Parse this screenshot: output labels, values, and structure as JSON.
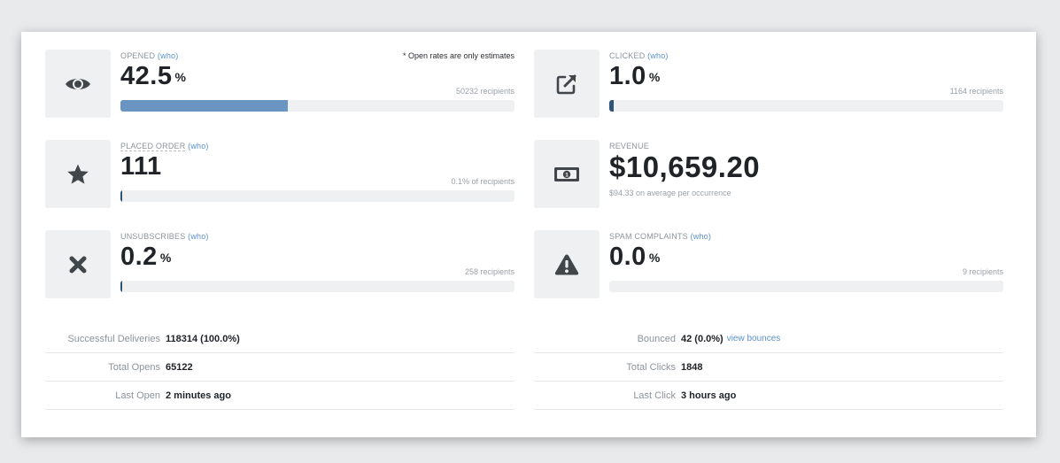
{
  "metrics": {
    "opened": {
      "label": "OPENED",
      "who": "(who)",
      "value": "42.5",
      "unit": "%",
      "note": "* Open rates are only estimates",
      "recipients": "50232 recipients",
      "progress": 0.425
    },
    "clicked": {
      "label": "CLICKED",
      "who": "(who)",
      "value": "1.0",
      "unit": "%",
      "recipients": "1164 recipients",
      "progress": 0.01
    },
    "placed_order": {
      "label": "PLACED ORDER",
      "who": "(who)",
      "value": "111",
      "recipients": "0.1% of recipients",
      "progress": 0.001
    },
    "revenue": {
      "label": "REVENUE",
      "value": "$10,659.20",
      "average": "$94.33 on average per occurrence"
    },
    "unsubscribes": {
      "label": "UNSUBSCRIBES",
      "who": "(who)",
      "value": "0.2",
      "unit": "%",
      "recipients": "258 recipients",
      "progress": 0.002
    },
    "spam": {
      "label": "SPAM COMPLAINTS",
      "who": "(who)",
      "value": "0.0",
      "unit": "%",
      "recipients": "9 recipients",
      "progress": 0.0
    }
  },
  "stats": {
    "deliveries": {
      "label": "Successful Deliveries",
      "value": "118314 (100.0%)"
    },
    "total_opens": {
      "label": "Total Opens",
      "value": "65122"
    },
    "last_open": {
      "label": "Last Open",
      "value": "2 minutes ago"
    },
    "bounced": {
      "label": "Bounced",
      "value": "42 (0.0%)",
      "link": "view bounces"
    },
    "total_clicks": {
      "label": "Total Clicks",
      "value": "1848"
    },
    "last_click": {
      "label": "Last Click",
      "value": "3 hours ago"
    }
  },
  "icons": {
    "opened": "eye-icon",
    "clicked": "external-link-icon",
    "placed_order": "star-icon",
    "revenue": "banknote-icon",
    "unsubscribes": "x-mark-icon",
    "spam": "warning-icon"
  },
  "colors": {
    "icon": "#41464b",
    "bar_fill": "#6a95c2",
    "bar_fill_dark": "#2e5577",
    "link": "#5a92c9"
  }
}
